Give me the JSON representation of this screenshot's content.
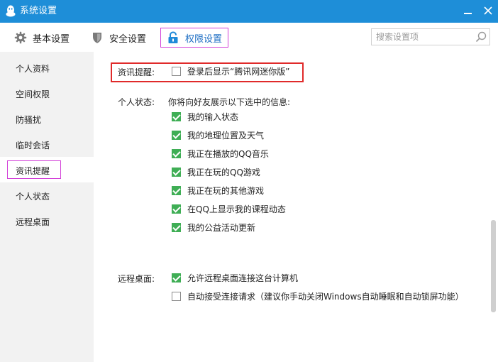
{
  "window": {
    "title": "系统设置"
  },
  "tabs": [
    {
      "label": "基本设置",
      "icon": "gear-icon"
    },
    {
      "label": "安全设置",
      "icon": "shield-icon"
    },
    {
      "label": "权限设置",
      "icon": "lock-icon",
      "active": true
    }
  ],
  "search": {
    "placeholder": "搜索设置项"
  },
  "sidebar": {
    "items": [
      {
        "label": "个人资料"
      },
      {
        "label": "空间权限"
      },
      {
        "label": "防骚扰"
      },
      {
        "label": "临时会话"
      },
      {
        "label": "资讯提醒",
        "active": true
      },
      {
        "label": "个人状态"
      },
      {
        "label": "远程桌面"
      }
    ]
  },
  "news": {
    "label": "资讯提醒:",
    "option": {
      "label": "登录后显示“腾讯网迷你版”",
      "checked": false
    }
  },
  "status": {
    "label": "个人状态:",
    "intro": "你将向好友展示以下选中的信息:",
    "options": [
      {
        "label": "我的输入状态",
        "checked": true
      },
      {
        "label": "我的地理位置及天气",
        "checked": true
      },
      {
        "label": "我正在播放的QQ音乐",
        "checked": true
      },
      {
        "label": "我正在玩的QQ游戏",
        "checked": true
      },
      {
        "label": "我正在玩的其他游戏",
        "checked": true
      },
      {
        "label": "在QQ上显示我的课程动态",
        "checked": true
      },
      {
        "label": "我的公益活动更新",
        "checked": true
      }
    ]
  },
  "remote": {
    "label": "远程桌面:",
    "options": [
      {
        "label": "允许远程桌面连接这台计算机",
        "checked": true
      },
      {
        "label": "自动接受连接请求（建议你手动关闭Windows自动睡眠和自动锁屏功能）",
        "checked": false
      }
    ]
  },
  "colors": {
    "titlebar": "#1e8ed8",
    "checked": "#3fae55",
    "highlight_box": "#e02a2a",
    "selection_box": "#d23fd8"
  }
}
